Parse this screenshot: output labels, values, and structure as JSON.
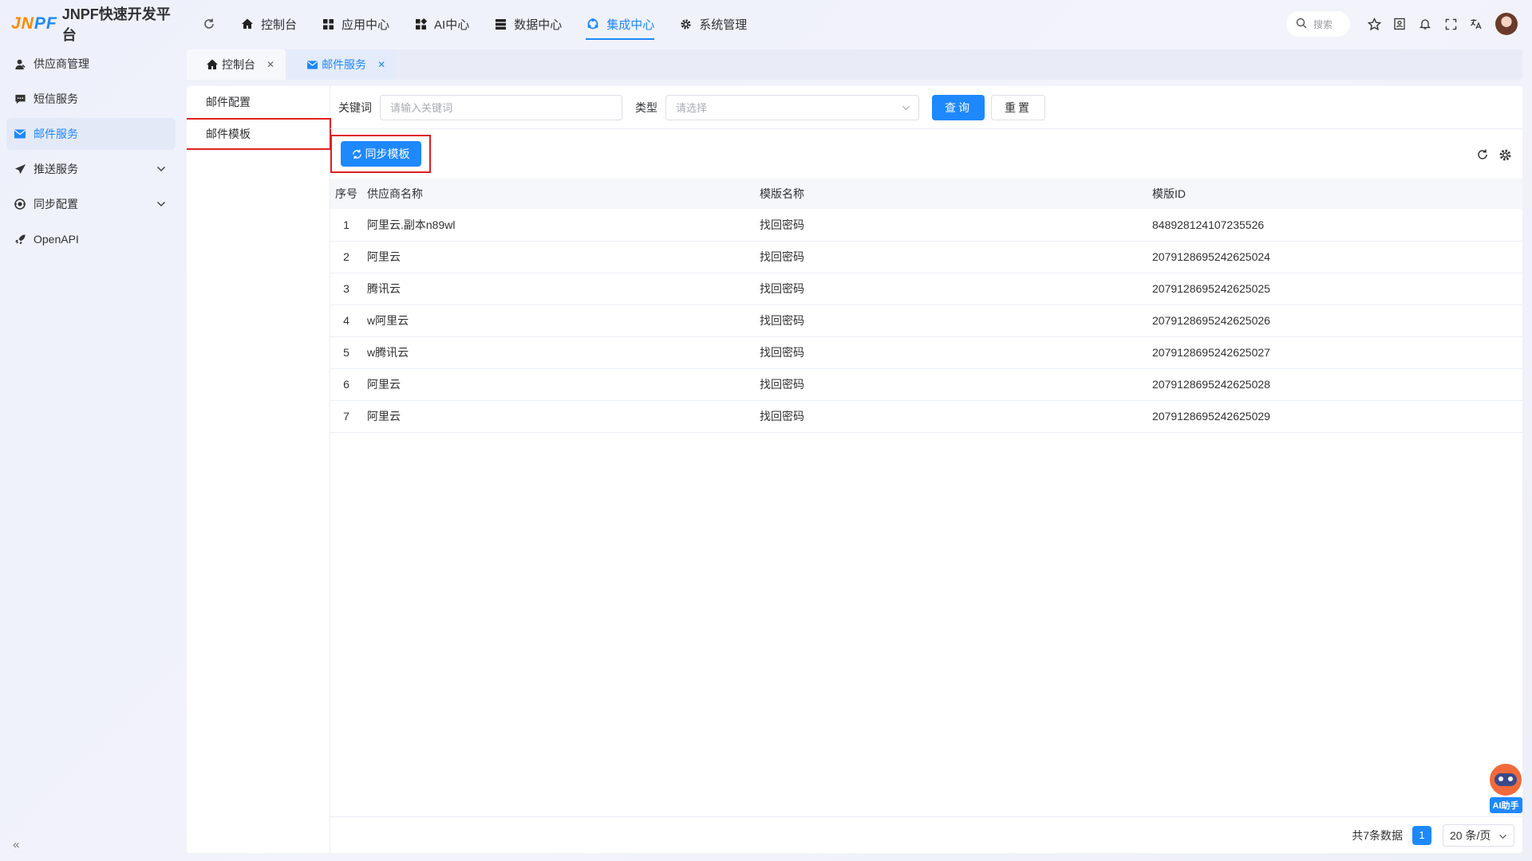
{
  "app": {
    "logo_mark_a": "JN",
    "logo_mark_b": "PF",
    "title": "JNPF快速开发平台"
  },
  "topnav": [
    {
      "label": "控制台",
      "icon": "home-icon"
    },
    {
      "label": "应用中心",
      "icon": "grid-icon"
    },
    {
      "label": "AI中心",
      "icon": "ai-grid-icon"
    },
    {
      "label": "数据中心",
      "icon": "database-icon"
    },
    {
      "label": "集成中心",
      "icon": "integration-icon",
      "active": true
    },
    {
      "label": "系统管理",
      "icon": "gear-icon"
    }
  ],
  "topright": {
    "search_placeholder": "搜索"
  },
  "sidebar": {
    "items": [
      {
        "label": "供应商管理",
        "icon": "user-icon"
      },
      {
        "label": "短信服务",
        "icon": "message-icon"
      },
      {
        "label": "邮件服务",
        "icon": "mail-icon",
        "active": true
      },
      {
        "label": "推送服务",
        "icon": "send-icon",
        "expandable": true
      },
      {
        "label": "同步配置",
        "icon": "sync-config-icon",
        "expandable": true
      },
      {
        "label": "OpenAPI",
        "icon": "rocket-icon"
      }
    ]
  },
  "tabs": [
    {
      "label": "控制台",
      "icon": "home-icon"
    },
    {
      "label": "邮件服务",
      "icon": "mail-icon",
      "active": true
    }
  ],
  "leftmenu": {
    "items": [
      "邮件配置",
      "邮件模板"
    ]
  },
  "filter": {
    "keyword_label": "关键词",
    "keyword_placeholder": "请输入关键词",
    "type_label": "类型",
    "type_placeholder": "请选择",
    "query_label": "查询",
    "reset_label": "重置"
  },
  "toolbar": {
    "sync_label": "同步模板"
  },
  "table": {
    "headers": [
      "序号",
      "供应商名称",
      "模版名称",
      "模版ID"
    ],
    "rows": [
      [
        "1",
        "阿里云.副本n89wl",
        "找回密码",
        "848928124107235526"
      ],
      [
        "2",
        "阿里云",
        "找回密码",
        "2079128695242625024"
      ],
      [
        "3",
        "腾讯云",
        "找回密码",
        "2079128695242625025"
      ],
      [
        "4",
        "w阿里云",
        "找回密码",
        "2079128695242625026"
      ],
      [
        "5",
        "w腾讯云",
        "找回密码",
        "2079128695242625027"
      ],
      [
        "6",
        "阿里云",
        "找回密码",
        "2079128695242625028"
      ],
      [
        "7",
        "阿里云",
        "找回密码",
        "2079128695242625029"
      ]
    ]
  },
  "pagination": {
    "total": "共7条数据",
    "current_page": "1",
    "page_size": "20 条/页"
  },
  "ai_helper": {
    "label": "AI助手"
  },
  "colors": {
    "primary": "#1e88ff",
    "highlight": "#e02020"
  }
}
